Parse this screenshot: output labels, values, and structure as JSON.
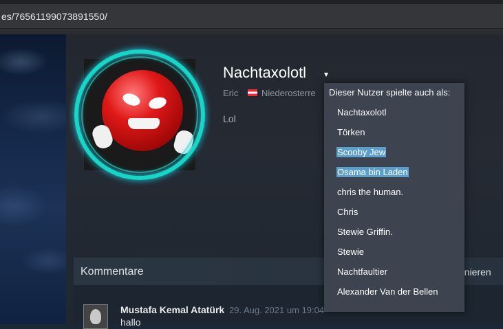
{
  "browser": {
    "url": "es/76561199073891550/"
  },
  "profile": {
    "persona_name": "Nachtaxolotl",
    "dropdown_arrow": "▾",
    "real_name": "Eric",
    "location": "Niederosterre",
    "summary": "Lol"
  },
  "alias_dropdown": {
    "header": "Dieser Nutzer spielte auch als:",
    "aliases": [
      {
        "name": "Nachtaxolotl"
      },
      {
        "name": "Törken"
      },
      {
        "name": "Scooby Jew",
        "selected": true
      },
      {
        "name": "Osama bin Laden",
        "selected": true
      },
      {
        "name": "chris the human."
      },
      {
        "name": "Chris"
      },
      {
        "name": "Stewie Griffin."
      },
      {
        "name": "Stewie"
      },
      {
        "name": "Nachtfaultier"
      },
      {
        "name": "Alexander Van der Bellen"
      }
    ]
  },
  "comments": {
    "title": "Kommentare",
    "subscribe_label": "nnieren",
    "items": [
      {
        "author": "Mustafa Kemal Atatürk",
        "date": "29. Aug. 2021 um 19:04",
        "text": "hallo"
      }
    ]
  },
  "colors": {
    "page_bg": "#1b2838",
    "dropdown_bg": "#3d4450",
    "selection": "#5c9fcd",
    "avatar_ring": "#18d6c6"
  }
}
